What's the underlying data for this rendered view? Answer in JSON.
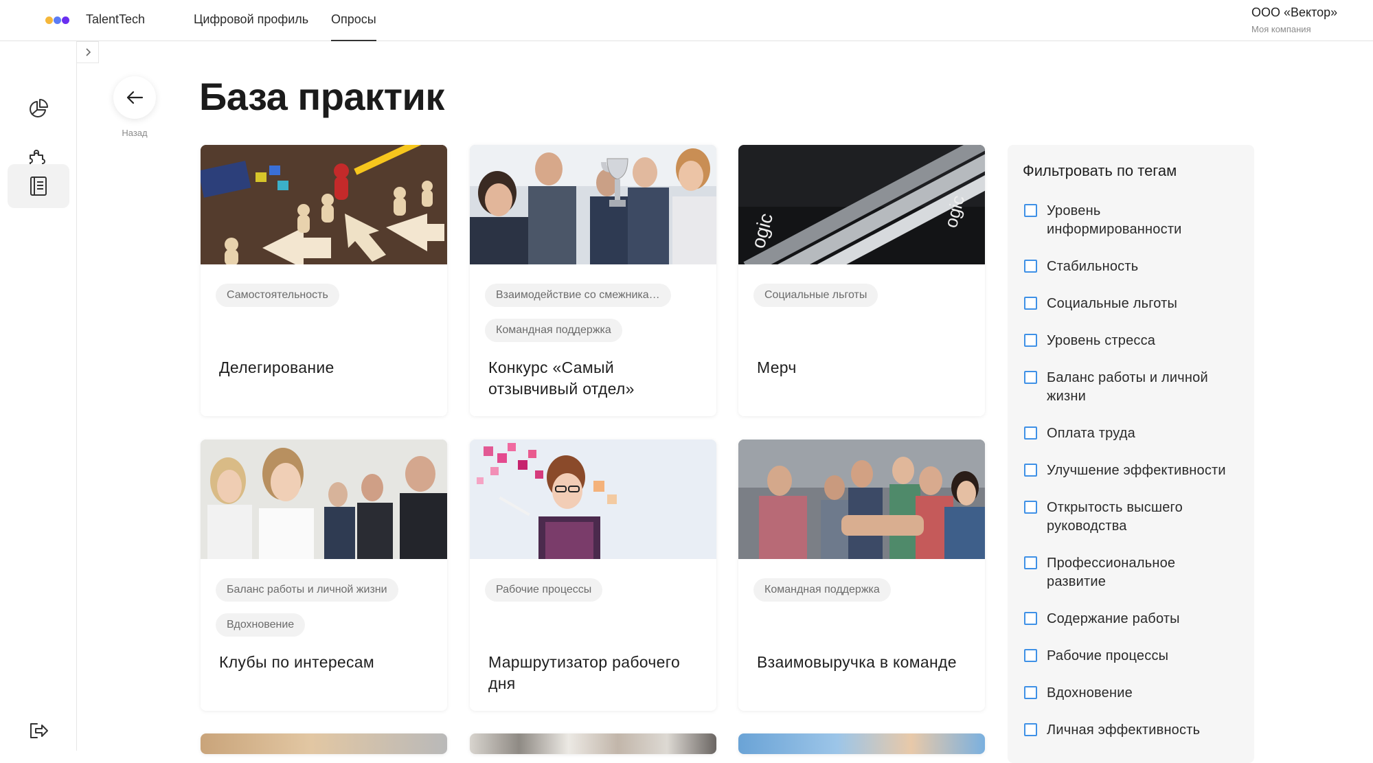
{
  "header": {
    "app_title": "TalentTech",
    "logo_colors": [
      "#f5b73a",
      "#5b7cf5",
      "#6a2ef0"
    ],
    "nav_tabs": [
      {
        "label": "Цифровой профиль",
        "active": false
      },
      {
        "label": "Опросы",
        "active": true
      }
    ],
    "company_name": "ООО «Вектор»",
    "company_subtitle": "Моя компания"
  },
  "sidebar": {
    "items": [
      {
        "icon": "pie-chart-icon",
        "active": false
      },
      {
        "icon": "puzzle-icon",
        "active": false
      },
      {
        "icon": "book-icon",
        "active": true
      }
    ],
    "logout_icon": "logout-icon",
    "collapse_icon": "chevron-right-icon"
  },
  "back": {
    "label": "Назад",
    "icon": "arrow-left-icon"
  },
  "page_title": "База практик",
  "cards": [
    {
      "tags": [
        "Самостоятельность"
      ],
      "title": "Делегирование"
    },
    {
      "tags": [
        "Взаимодействие со смежника…",
        "Командная поддержка"
      ],
      "title": "Конкурс «Самый отзывчивый отдел»"
    },
    {
      "tags": [
        "Социальные льготы"
      ],
      "title": "Мерч"
    },
    {
      "tags": [
        "Баланс работы и личной жизни",
        "Вдохновение"
      ],
      "title": "Клубы по интересам"
    },
    {
      "tags": [
        "Рабочие процессы"
      ],
      "title": "Маршрутизатор рабочего дня"
    },
    {
      "tags": [
        "Командная поддержка"
      ],
      "title": "Взаимовыручка в команде"
    }
  ],
  "filter": {
    "title": "Фильтровать по тегам",
    "items": [
      {
        "label": "Уровень информированности",
        "checked": false
      },
      {
        "label": "Стабильность",
        "checked": false
      },
      {
        "label": "Социальные льготы",
        "checked": false
      },
      {
        "label": "Уровень стресса",
        "checked": false
      },
      {
        "label": "Баланс работы и личной жизни",
        "checked": false
      },
      {
        "label": "Оплата труда",
        "checked": false
      },
      {
        "label": "Улучшение эффективности",
        "checked": false
      },
      {
        "label": "Открытость высшего руководства",
        "checked": false
      },
      {
        "label": "Профессиональное развитие",
        "checked": false
      },
      {
        "label": "Содержание работы",
        "checked": false
      },
      {
        "label": "Рабочие процессы",
        "checked": false
      },
      {
        "label": "Вдохновение",
        "checked": false
      },
      {
        "label": "Личная эффективность",
        "checked": false
      }
    ]
  },
  "colors": {
    "checkbox_accent": "#3e90e6",
    "tag_bg": "#f2f2f2",
    "panel_bg": "#f6f6f6"
  }
}
